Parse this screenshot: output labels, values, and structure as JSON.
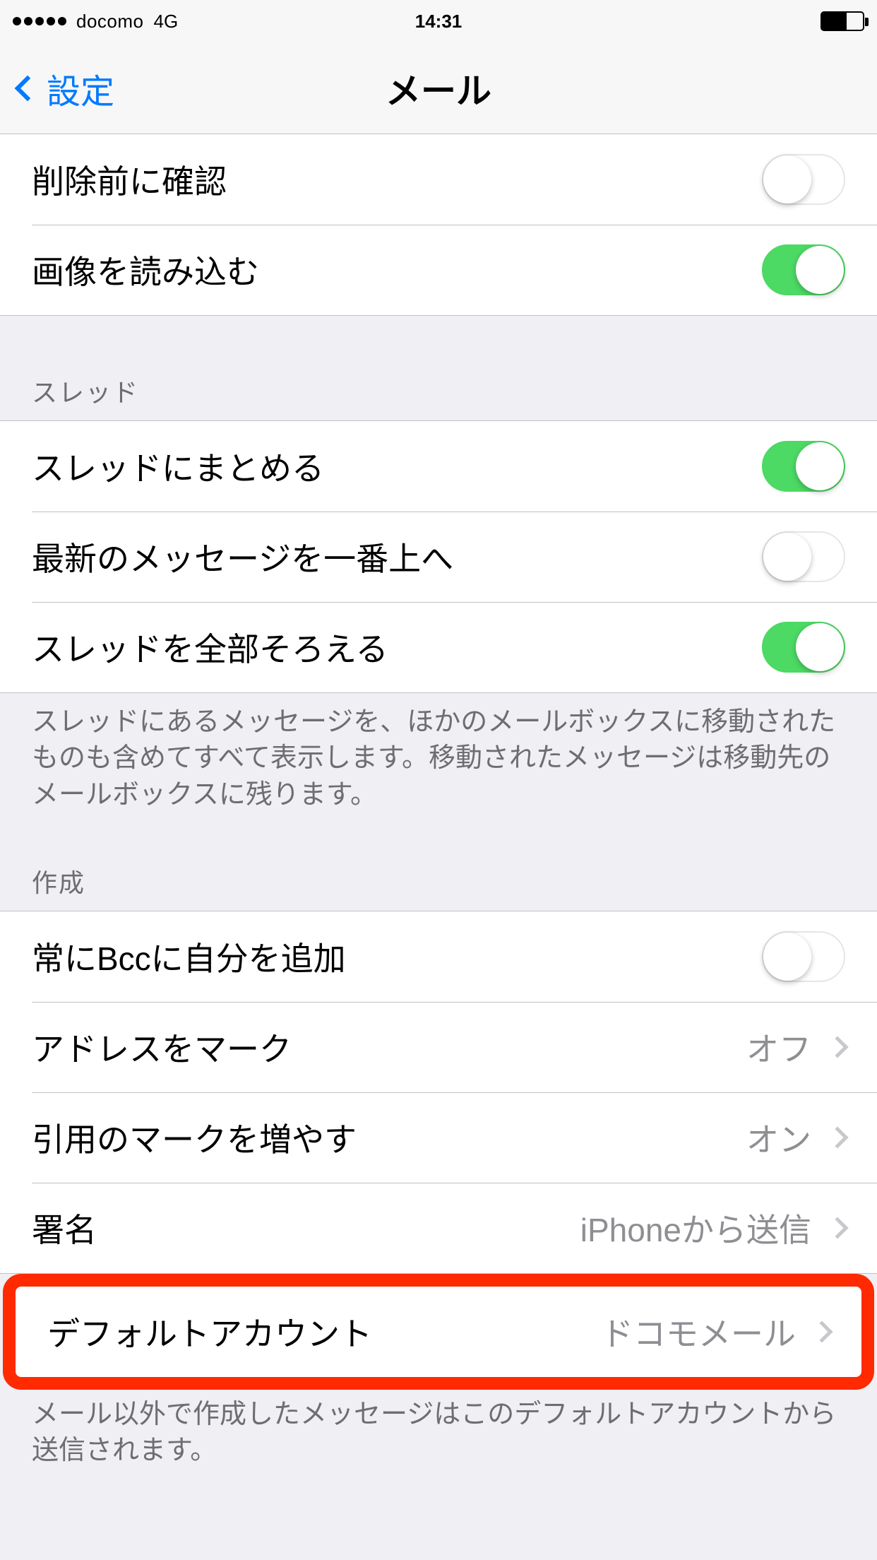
{
  "statusbar": {
    "carrier": "docomo",
    "network": "4G",
    "time": "14:31"
  },
  "navbar": {
    "back": "設定",
    "title": "メール"
  },
  "rows": {
    "confirm_delete": "削除前に確認",
    "load_images": "画像を読み込む",
    "thread_header": "スレッド",
    "organize_thread": "スレッドにまとめる",
    "most_recent_top": "最新のメッセージを一番上へ",
    "complete_threads": "スレッドを全部そろえる",
    "thread_footer": "スレッドにあるメッセージを、ほかのメールボックスに移動されたものも含めてすべて表示します。移動されたメッセージは移動先のメールボックスに残ります。",
    "compose_header": "作成",
    "always_bcc": "常にBccに自分を追加",
    "mark_addresses_label": "アドレスをマーク",
    "mark_addresses_value": "オフ",
    "increase_quote_label": "引用のマークを増やす",
    "increase_quote_value": "オン",
    "signature_label": "署名",
    "signature_value": "iPhoneから送信",
    "default_account_label": "デフォルトアカウント",
    "default_account_value": "ドコモメール",
    "default_account_footer": "メール以外で作成したメッセージはこのデフォルトアカウントから送信されます。"
  }
}
